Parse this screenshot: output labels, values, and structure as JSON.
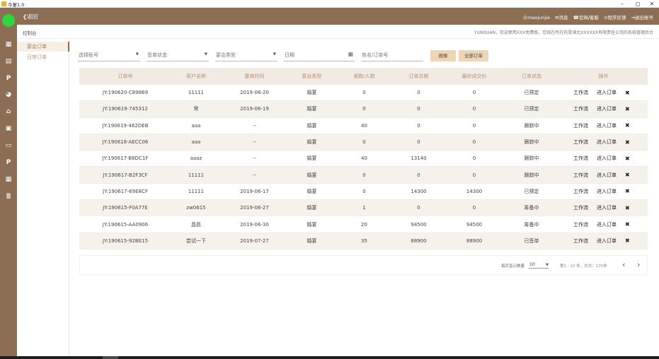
{
  "window": {
    "title": "今宴1.0",
    "controls": {
      "minimize": "–",
      "maximize": "◻",
      "close": "✕"
    }
  },
  "topbar": {
    "back_label": "❮返回",
    "links": [
      {
        "icon": "user-icon",
        "label": "Ⓐmaojunjie"
      },
      {
        "icon": "message-icon",
        "label": "✉消息"
      },
      {
        "icon": "service-icon",
        "label": "☎官网/客服"
      },
      {
        "icon": "feedback-icon",
        "label": "⊙程序反馈"
      },
      {
        "icon": "logout-icon",
        "label": "⇥退出账号"
      }
    ]
  },
  "breadcrumb": {
    "label": "控制台",
    "welcome": "YUNDUAN，欢迎使用XXX免费版，您现在所在的是湖北XXXXXX有限责任公司的系统管理后台"
  },
  "sidebar": {
    "items": [
      {
        "label": "宴会订单",
        "active": true
      },
      {
        "label": "日常订单",
        "active": false
      }
    ]
  },
  "rail_icons": [
    "grid-icon",
    "calendar-icon",
    "p-icon",
    "users-icon",
    "bank-icon",
    "layout-icon",
    "list-icon",
    "p-icon",
    "dashboard-icon",
    "database-icon"
  ],
  "filters": {
    "account_placeholder": "选择账号",
    "status_placeholder": "签单状态",
    "type_placeholder": "宴会类型",
    "date_placeholder": "日期",
    "search_placeholder": "姓名/订单号",
    "search_button": "搜索",
    "all_orders_button": "全部订单"
  },
  "table": {
    "headers": [
      "订单号",
      "客户名称",
      "宴席时间",
      "宴会类型",
      "桌数/人数",
      "订单总额",
      "最终成交价",
      "订单状态",
      "操作"
    ],
    "op_workflow": "工作流",
    "op_enter": "进入订单",
    "op_delete": "✖",
    "rows": [
      [
        "JY:190620-C89869",
        "11111",
        "2019-06-20",
        "婚宴",
        "0",
        "0",
        "0",
        "已预定"
      ],
      [
        "JY:190619-745312",
        "常",
        "2019-06-19",
        "婚宴",
        "0",
        "0",
        "0",
        "已预定"
      ],
      [
        "JY:190619-462DEB",
        "aaa",
        "--",
        "婚宴",
        "40",
        "0",
        "0",
        "跟踪中"
      ],
      [
        "JY:190618-AECC06",
        "aaa",
        "--",
        "婚宴",
        "0",
        "0",
        "0",
        "跟踪中"
      ],
      [
        "JY:190617-B8DC1F",
        "aaaz",
        "--",
        "婚宴",
        "40",
        "13140",
        "0",
        "跟踪中"
      ],
      [
        "JY:190617-B2F3CF",
        "11111",
        "--",
        "婚宴",
        "0",
        "0",
        "0",
        "跟踪中"
      ],
      [
        "JY:190617-69E8CF",
        "11111",
        "2019-06-17",
        "婚宴",
        "0",
        "14300",
        "14300",
        "已预定"
      ],
      [
        "JY:190615-F0A77E",
        "zw0615",
        "2019-06-27",
        "婚宴",
        "1",
        "0",
        "0",
        "筹备中"
      ],
      [
        "JY:190615-AA0906",
        "昌邑",
        "2019-06-30",
        "婚宴",
        "20",
        "94500",
        "94500",
        "筹备中"
      ],
      [
        "JY:190615-92BE15",
        "尝试一下",
        "2019-07-27",
        "婚宴",
        "35",
        "88900",
        "88900",
        "已签单"
      ]
    ]
  },
  "pager": {
    "page_size_label": "每页显示数量",
    "page_size": "10",
    "info": "第1 - 10 条，总共：170条",
    "prev": "‹",
    "next": "›"
  },
  "colors": {
    "brand": "#8b6e53",
    "accent": "#efd5b6",
    "header_text": "#b39273",
    "avatar": "#2fd53a"
  }
}
